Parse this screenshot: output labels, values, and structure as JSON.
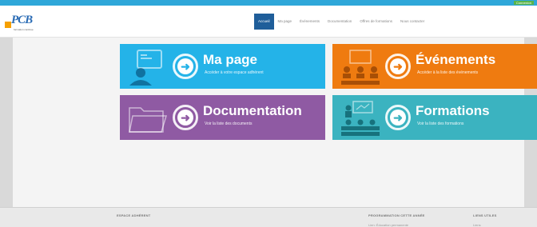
{
  "topbar": {
    "connexion_label": "Connexion"
  },
  "header": {
    "logo_text": "PCB",
    "logo_subtitle": "formation continue",
    "nav": [
      "Accueil",
      "Ma page",
      "Événements",
      "Documentation",
      "Offres de formations",
      "Nous contacter"
    ]
  },
  "tiles": [
    {
      "title": "Ma page",
      "subtitle": "Accéder à votre espace adhérent"
    },
    {
      "title": "Événements",
      "subtitle": "Accéder à la liste des événements"
    },
    {
      "title": "Documentation",
      "subtitle": "Voir la liste des documents"
    },
    {
      "title": "Formations",
      "subtitle": "Voir la liste des formations"
    }
  ],
  "footer": {
    "col1_title": "ESPACE ADHÉRENT",
    "col2_title": "PROGRAMMATION CETTE ANNÉE",
    "col2_item": "Lien: Éducation permanente",
    "col3_title": "LIENS UTILES",
    "col3_item": "Liens"
  },
  "colors": {
    "topbar": "#2fa7d9",
    "nav_active": "#1f5e9a",
    "tile_blue": "#24b3e8",
    "tile_orange": "#ef7b10",
    "tile_purple": "#8f5aa3",
    "tile_teal": "#3bb3c0"
  },
  "icons": [
    "person-monitor-icon",
    "audience-icon",
    "folder-icon",
    "classroom-icon",
    "arrow-right-icon"
  ]
}
